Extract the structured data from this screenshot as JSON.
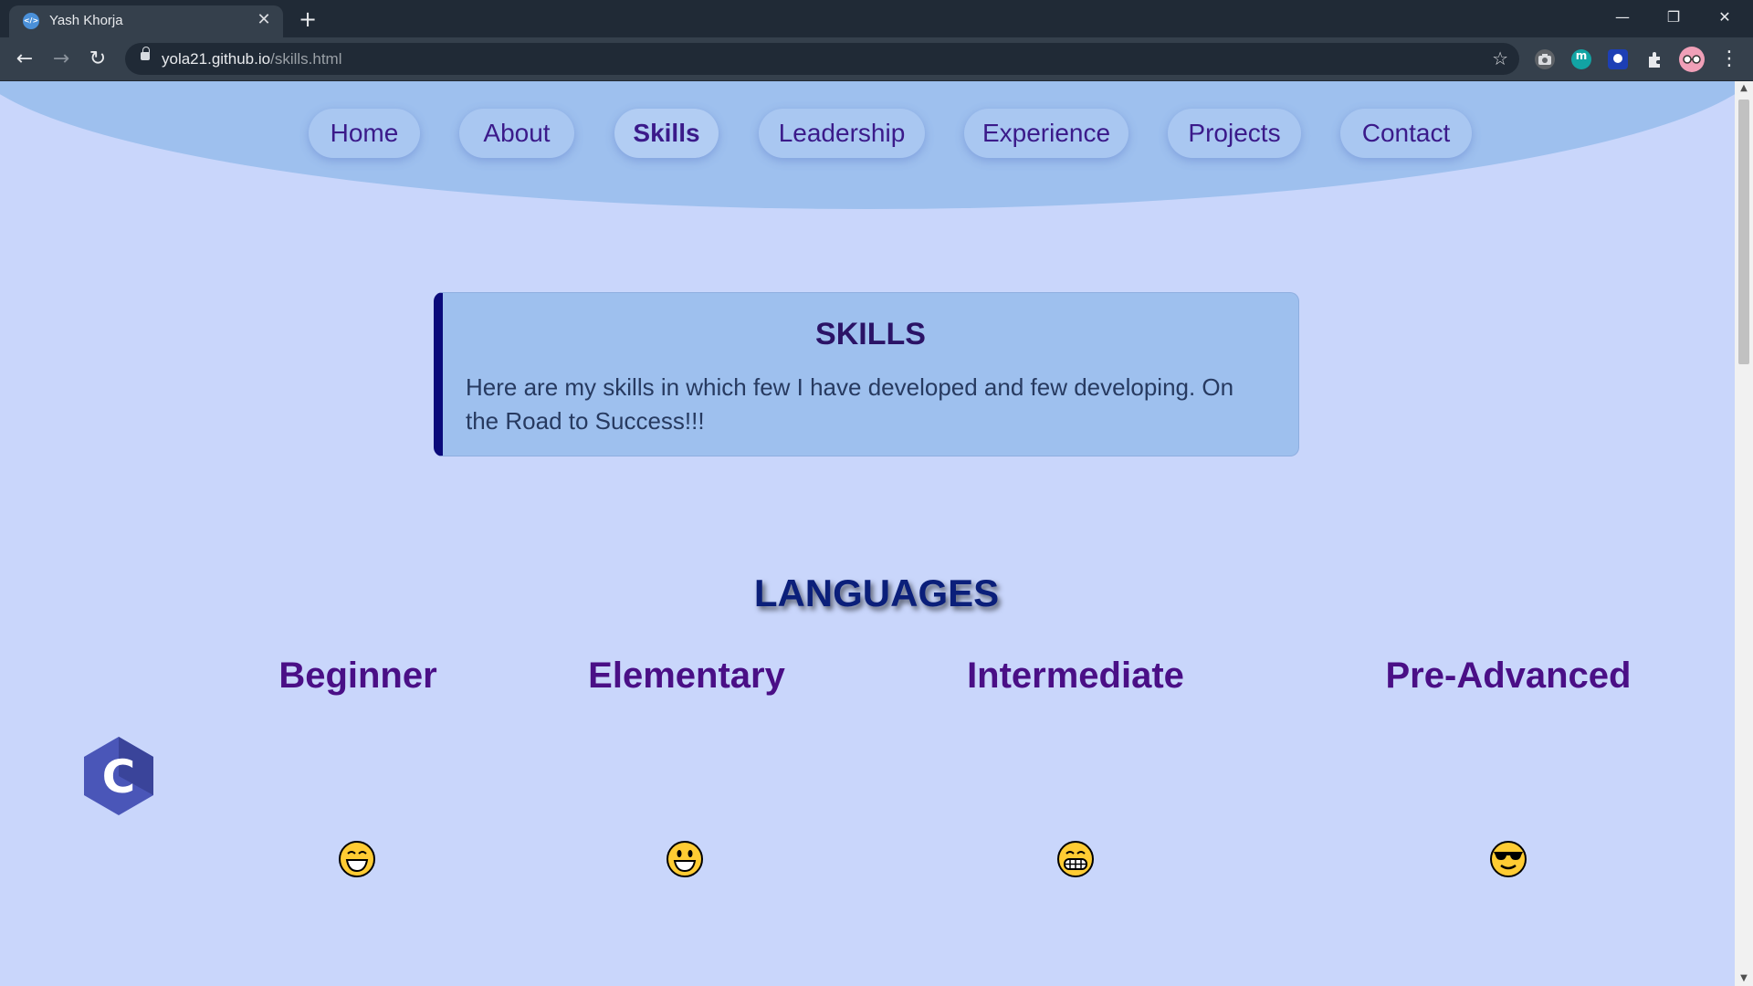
{
  "browser": {
    "tab_title": "Yash Khorja",
    "tab_close": "✕",
    "new_tab": "+",
    "url_host": "yola21.github.io",
    "url_path": "/skills.html",
    "back": "←",
    "forward": "→",
    "reload": "↻",
    "star": "☆",
    "minimize": "—",
    "restore": "❐",
    "close": "✕",
    "extension_m": "m",
    "menu": "⋮"
  },
  "nav": {
    "items": [
      "Home",
      "About",
      "Skills",
      "Leadership",
      "Experience",
      "Projects",
      "Contact"
    ],
    "active": "Skills"
  },
  "intro": {
    "title": "SKILLS",
    "body": "Here are my skills in which few I have developed and few developing. On the Road to Success!!!"
  },
  "languages": {
    "title": "LANGUAGES",
    "levels": [
      "Beginner",
      "Elementary",
      "Intermediate",
      "Pre-Advanced"
    ],
    "emojis": [
      "grinning-squint-face",
      "grinning-face",
      "grimacing-grin-face",
      "sunglasses-face"
    ],
    "logo": "c-language-logo",
    "logo_letter": "C"
  },
  "colors": {
    "page_bg": "#c9d6fb",
    "header_bg": "#9ec0ee",
    "nav_text": "#3b1a8a",
    "card_border_accent": "#0a0a7a",
    "level_text": "#4a0f86",
    "section_title": "#0b1f7a"
  }
}
